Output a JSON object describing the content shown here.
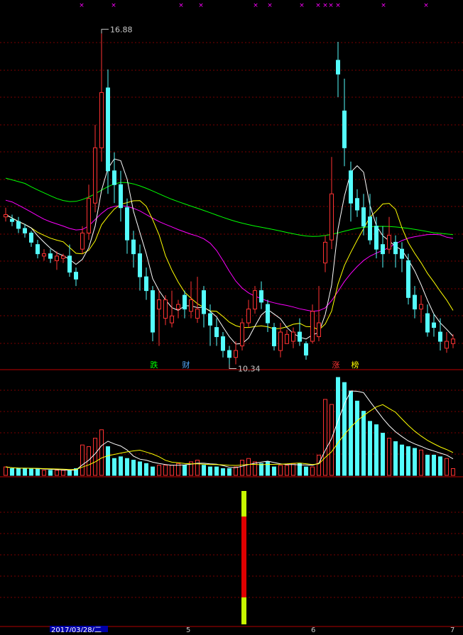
{
  "chart_data": [
    {
      "type": "candlestick",
      "panel": "price",
      "title": "",
      "colors": {
        "up": "#ff3232",
        "down": "#54fcfc",
        "ma5": "#ffffff",
        "ma10": "#ffff00",
        "ma20": "#ff00ff",
        "ma60": "#00ff00",
        "marker": "#ff00ff"
      },
      "high_label": "16.88",
      "low_label": "10.34",
      "annotations": [
        {
          "text": "跌",
          "color": "#00ff00"
        },
        {
          "text": "财",
          "color": "#54a8fc"
        },
        {
          "text": "涨",
          "color": "#ff3232"
        },
        {
          "text": "榜",
          "color": "#ffff00"
        }
      ],
      "marker_glyph": "×",
      "marker_count": 12,
      "candles": [
        [
          12.9,
          12.95,
          13.1,
          12.8
        ],
        [
          12.85,
          12.8,
          12.95,
          12.7
        ],
        [
          12.8,
          12.65,
          12.9,
          12.55
        ],
        [
          12.65,
          12.55,
          12.75,
          12.45
        ],
        [
          12.55,
          12.35,
          12.6,
          12.25
        ],
        [
          12.3,
          12.1,
          12.4,
          12.0
        ],
        [
          12.05,
          12.1,
          12.2,
          11.95
        ],
        [
          12.1,
          12.0,
          12.2,
          11.9
        ],
        [
          11.95,
          12.05,
          12.15,
          11.75
        ],
        [
          12.0,
          12.05,
          12.1,
          11.9
        ],
        [
          12.05,
          11.7,
          12.3,
          11.6
        ],
        [
          11.7,
          11.55,
          11.8,
          11.4
        ],
        [
          12.2,
          12.55,
          12.7,
          12.1
        ],
        [
          12.55,
          13.3,
          13.6,
          12.4
        ],
        [
          13.2,
          14.4,
          14.9,
          13.0
        ],
        [
          14.4,
          15.6,
          16.88,
          14.1
        ],
        [
          15.7,
          13.9,
          16.1,
          13.4
        ],
        [
          13.9,
          13.6,
          14.3,
          13.2
        ],
        [
          13.6,
          13.1,
          13.9,
          12.8
        ],
        [
          13.1,
          12.4,
          13.3,
          12.1
        ],
        [
          12.4,
          12.1,
          12.6,
          11.8
        ],
        [
          12.1,
          11.6,
          12.3,
          11.3
        ],
        [
          11.6,
          11.3,
          11.8,
          11.1
        ],
        [
          11.3,
          10.4,
          11.4,
          10.2
        ],
        [
          10.9,
          11.1,
          11.3,
          10.1
        ],
        [
          10.7,
          11.1,
          11.2,
          10.55
        ],
        [
          10.6,
          10.75,
          11.3,
          10.5
        ],
        [
          10.9,
          11.0,
          11.1,
          10.7
        ],
        [
          11.2,
          10.9,
          11.3,
          10.7
        ],
        [
          10.85,
          11.1,
          11.5,
          10.7
        ],
        [
          10.7,
          10.9,
          11.6,
          10.6
        ],
        [
          11.3,
          10.8,
          11.4,
          10.5
        ],
        [
          10.8,
          10.55,
          11.0,
          10.1
        ],
        [
          10.5,
          10.3,
          10.7,
          10.1
        ],
        [
          10.3,
          10.0,
          10.4,
          9.85
        ],
        [
          10.0,
          9.85,
          10.1,
          9.7
        ],
        [
          9.85,
          10.0,
          10.2,
          9.7
        ],
        [
          10.1,
          10.6,
          10.7,
          10.0
        ],
        [
          10.6,
          10.9,
          11.1,
          10.5
        ],
        [
          10.9,
          11.3,
          11.4,
          10.8
        ],
        [
          11.3,
          11.05,
          11.5,
          10.9
        ],
        [
          11.0,
          10.6,
          11.1,
          10.4
        ],
        [
          10.5,
          10.1,
          10.6,
          10.0
        ],
        [
          10.0,
          10.4,
          10.6,
          9.85
        ],
        [
          10.15,
          10.35,
          10.45,
          10.2
        ],
        [
          10.2,
          10.4,
          10.5,
          10.05
        ],
        [
          10.4,
          10.2,
          10.7,
          10.1
        ],
        [
          10.15,
          9.9,
          10.2,
          9.8
        ],
        [
          10.2,
          10.85,
          11.0,
          10.15
        ],
        [
          10.3,
          10.6,
          11.4,
          10.2
        ],
        [
          11.9,
          12.35,
          12.5,
          11.7
        ],
        [
          12.4,
          13.4,
          14.2,
          12.2
        ],
        [
          16.3,
          16.0,
          16.7,
          15.5
        ],
        [
          15.2,
          14.4,
          15.9,
          14.0
        ],
        [
          13.9,
          13.2,
          14.1,
          12.8
        ],
        [
          13.3,
          13.05,
          13.5,
          12.9
        ],
        [
          13.1,
          12.7,
          13.4,
          12.5
        ],
        [
          12.9,
          12.4,
          13.4,
          12.3
        ],
        [
          12.7,
          12.2,
          12.9,
          12.0
        ],
        [
          12.3,
          12.1,
          12.7,
          11.8
        ],
        [
          12.2,
          12.5,
          12.9,
          12.1
        ],
        [
          12.35,
          12.1,
          12.5,
          11.8
        ],
        [
          12.2,
          12.0,
          12.35,
          11.7
        ],
        [
          11.95,
          11.15,
          12.1,
          11.0
        ],
        [
          11.2,
          10.9,
          11.4,
          10.7
        ],
        [
          10.9,
          11.0,
          11.2,
          10.6
        ],
        [
          10.8,
          10.4,
          11.0,
          10.3
        ],
        [
          10.6,
          10.5,
          10.8,
          10.3
        ],
        [
          10.4,
          10.2,
          10.7,
          10.0
        ],
        [
          10.05,
          10.2,
          10.4,
          9.95
        ],
        [
          10.15,
          10.25,
          10.35,
          10.05
        ]
      ],
      "ylim": [
        9.6,
        17.3
      ]
    },
    {
      "type": "bar",
      "panel": "volume",
      "series": [
        {
          "values": [
            5,
            4,
            4,
            4,
            4,
            4,
            3,
            3,
            3,
            3,
            3,
            4,
            18,
            17,
            22,
            27,
            17,
            10,
            11,
            10,
            9,
            8,
            7,
            5,
            6,
            6,
            6,
            7,
            6,
            8,
            9,
            6,
            5,
            5,
            4,
            4,
            5,
            9,
            10,
            8,
            7,
            8,
            5,
            6,
            6,
            7,
            7,
            5,
            5,
            12,
            45,
            42,
            58,
            55,
            50,
            44,
            38,
            32,
            30,
            25,
            22,
            20,
            18,
            17,
            16,
            15,
            12,
            12,
            11,
            10,
            4
          ]
        }
      ]
    },
    {
      "type": "bar",
      "panel": "indicator",
      "colors": {
        "outer": "#c8f800",
        "inner": "#e00000"
      }
    }
  ],
  "date_bar": {
    "date_label": "2017/03/28/二",
    "months": [
      "5",
      "6",
      "7"
    ]
  }
}
